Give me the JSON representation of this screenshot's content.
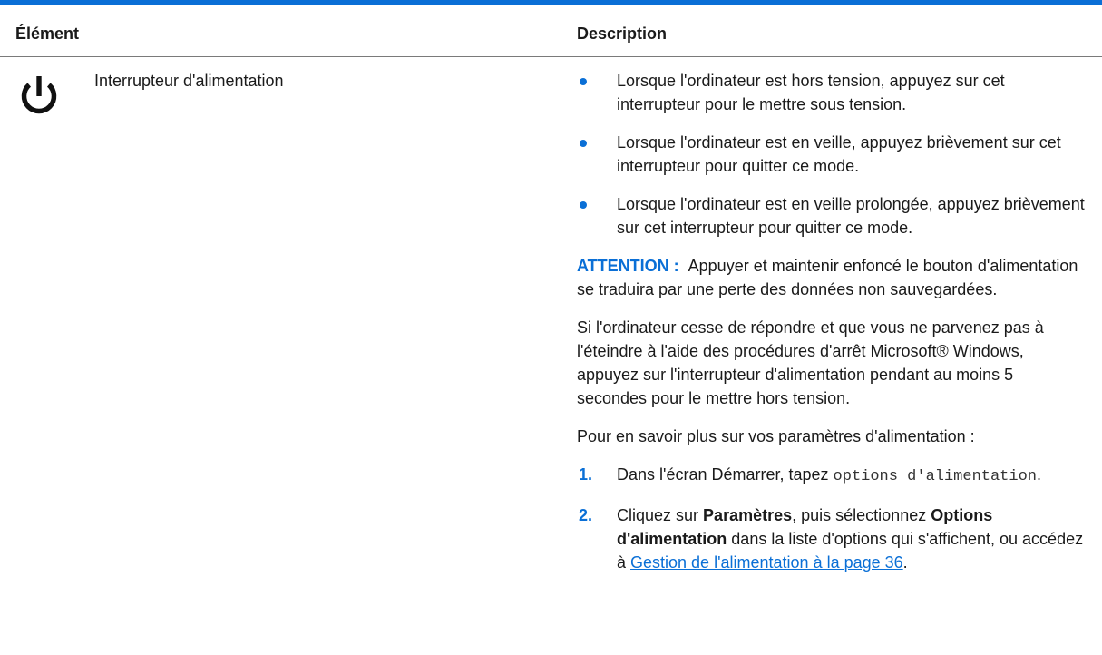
{
  "table": {
    "header_element": "Élément",
    "header_description": "Description"
  },
  "row": {
    "icon": "power-icon",
    "element_name": "Interrupteur d'alimentation",
    "bullets": [
      "Lorsque l'ordinateur est hors tension, appuyez sur cet interrupteur pour le mettre sous tension.",
      "Lorsque l'ordinateur est en veille, appuyez brièvement sur cet interrupteur pour quitter ce mode.",
      "Lorsque l'ordinateur est en veille prolongée, appuyez brièvement sur cet interrupteur pour quitter ce mode."
    ],
    "attention_label": "ATTENTION :",
    "attention_text": "Appuyer et maintenir enfoncé le bouton d'alimentation se traduira par une perte des données non sauvegardées.",
    "paragraph_unresponsive": "Si l'ordinateur cesse de répondre et que vous ne parvenez pas à l'éteindre à l'aide des procédures d'arrêt Microsoft® Windows, appuyez sur l'interrupteur d'alimentation pendant au moins 5 secondes pour le mettre hors tension.",
    "paragraph_more_info": "Pour en savoir plus sur vos paramètres d'alimentation :",
    "steps": [
      {
        "number": "1.",
        "text_before": "Dans l'écran Démarrer, tapez ",
        "code": "options d'alimentation",
        "text_after": "."
      },
      {
        "number": "2.",
        "text_1": "Cliquez sur ",
        "bold_1": "Paramètres",
        "text_2": ", puis sélectionnez ",
        "bold_2": "Options d'alimentation",
        "text_3": " dans la liste d'options qui s'affichent, ou accédez à ",
        "link": "Gestion de l'alimentation à la page 36",
        "text_4": "."
      }
    ]
  },
  "colors": {
    "accent": "#0a6fd6",
    "text": "#1a1a1a",
    "rule": "#7a7a7a"
  }
}
